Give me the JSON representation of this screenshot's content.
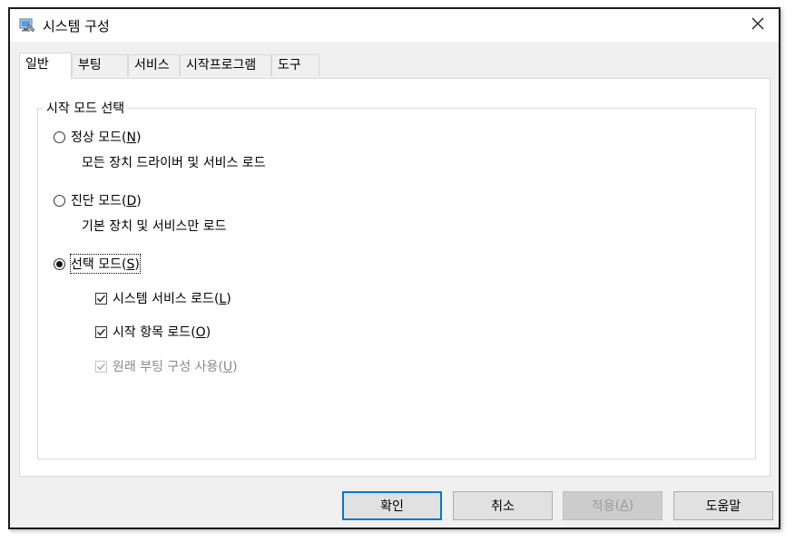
{
  "window": {
    "title": "시스템 구성",
    "close_icon": "close-icon",
    "app_icon": "system-config-icon"
  },
  "tabs": [
    {
      "label": "일반",
      "active": true
    },
    {
      "label": "부팅",
      "active": false
    },
    {
      "label": "서비스",
      "active": false
    },
    {
      "label": "시작프로그램",
      "active": false
    },
    {
      "label": "도구",
      "active": false
    }
  ],
  "group": {
    "title": "시작 모드 선택"
  },
  "radios": [
    {
      "label": "정상 모드",
      "mnemonic": "N",
      "description": "모든 장치 드라이버 및 서비스 로드",
      "checked": false
    },
    {
      "label": "진단 모드",
      "mnemonic": "D",
      "description": "기본 장치 및 서비스만 로드",
      "checked": false
    },
    {
      "label": "선택 모드",
      "mnemonic": "S",
      "checked": true
    }
  ],
  "checkboxes": [
    {
      "label": "시스템 서비스 로드",
      "mnemonic": "L",
      "checked": true,
      "enabled": true
    },
    {
      "label": "시작 항목 로드",
      "mnemonic": "O",
      "checked": true,
      "enabled": true
    },
    {
      "label": "원래 부팅 구성 사용",
      "mnemonic": "U",
      "checked": true,
      "enabled": false
    }
  ],
  "buttons": {
    "ok": "확인",
    "cancel": "취소",
    "apply": "적용",
    "apply_mnemonic": "A",
    "help": "도움말"
  },
  "colors": {
    "accent": "#0078d7",
    "dialog_bg": "#f0f0f0",
    "disabled_text": "#8a8a8a"
  }
}
